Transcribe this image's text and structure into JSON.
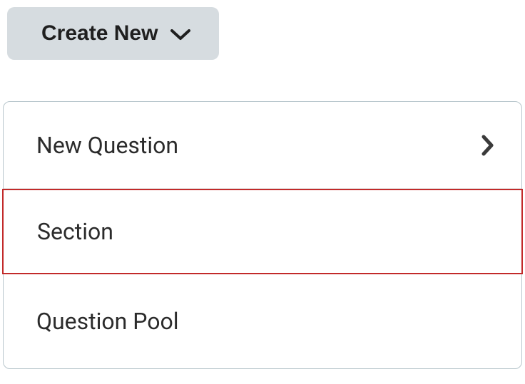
{
  "button": {
    "label": "Create New"
  },
  "menu": {
    "items": [
      {
        "label": "New Question",
        "hasSubmenu": true
      },
      {
        "label": "Section",
        "hasSubmenu": false,
        "highlighted": true
      },
      {
        "label": "Question Pool",
        "hasSubmenu": false
      }
    ]
  }
}
